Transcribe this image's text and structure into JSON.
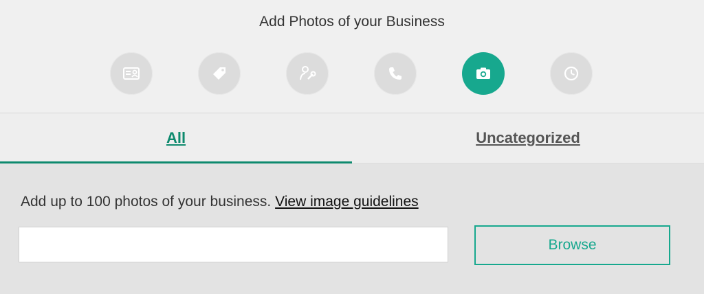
{
  "header": {
    "title": "Add Photos of your Business"
  },
  "steps": [
    {
      "icon": "id-card-icon",
      "active": false
    },
    {
      "icon": "tag-icon",
      "active": false
    },
    {
      "icon": "person-wrench-icon",
      "active": false
    },
    {
      "icon": "phone-icon",
      "active": false
    },
    {
      "icon": "camera-icon",
      "active": true
    },
    {
      "icon": "clock-icon",
      "active": false
    }
  ],
  "colors": {
    "accent": "#17a88e",
    "tab_active": "#0e8a6e",
    "icon_inactive": "#dcdcdc"
  },
  "tabs": [
    {
      "label": "All",
      "active": true
    },
    {
      "label": "Uncategorized",
      "active": false
    }
  ],
  "upload": {
    "description": "Add up to 100 photos of your business.",
    "guidelines_link": "View image guidelines",
    "file_value": "",
    "browse_label": "Browse"
  }
}
